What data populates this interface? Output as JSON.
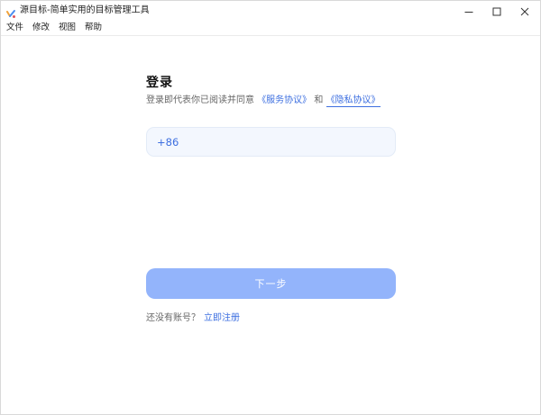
{
  "window": {
    "title": "源目标-简单实用的目标管理工具"
  },
  "menu": {
    "items": [
      "文件",
      "修改",
      "视图",
      "帮助"
    ]
  },
  "login": {
    "title": "登录",
    "agreement_prefix": "登录即代表你已阅读并同意",
    "service_agreement": "《服务协议》",
    "conjunction": "和",
    "privacy_policy": "《隐私协议》",
    "country_code": "+86",
    "phone_value": "",
    "next_button": "下一步",
    "no_account_hint": "还没有账号？",
    "register_link": "立即注册"
  },
  "colors": {
    "accent": "#3d6fe0",
    "button_disabled": "#93b4fb",
    "input_background": "#f3f7fe"
  },
  "icons": {
    "app": "app-logo-icon",
    "minimize": "minimize-icon",
    "maximize": "maximize-icon",
    "close": "close-icon"
  }
}
